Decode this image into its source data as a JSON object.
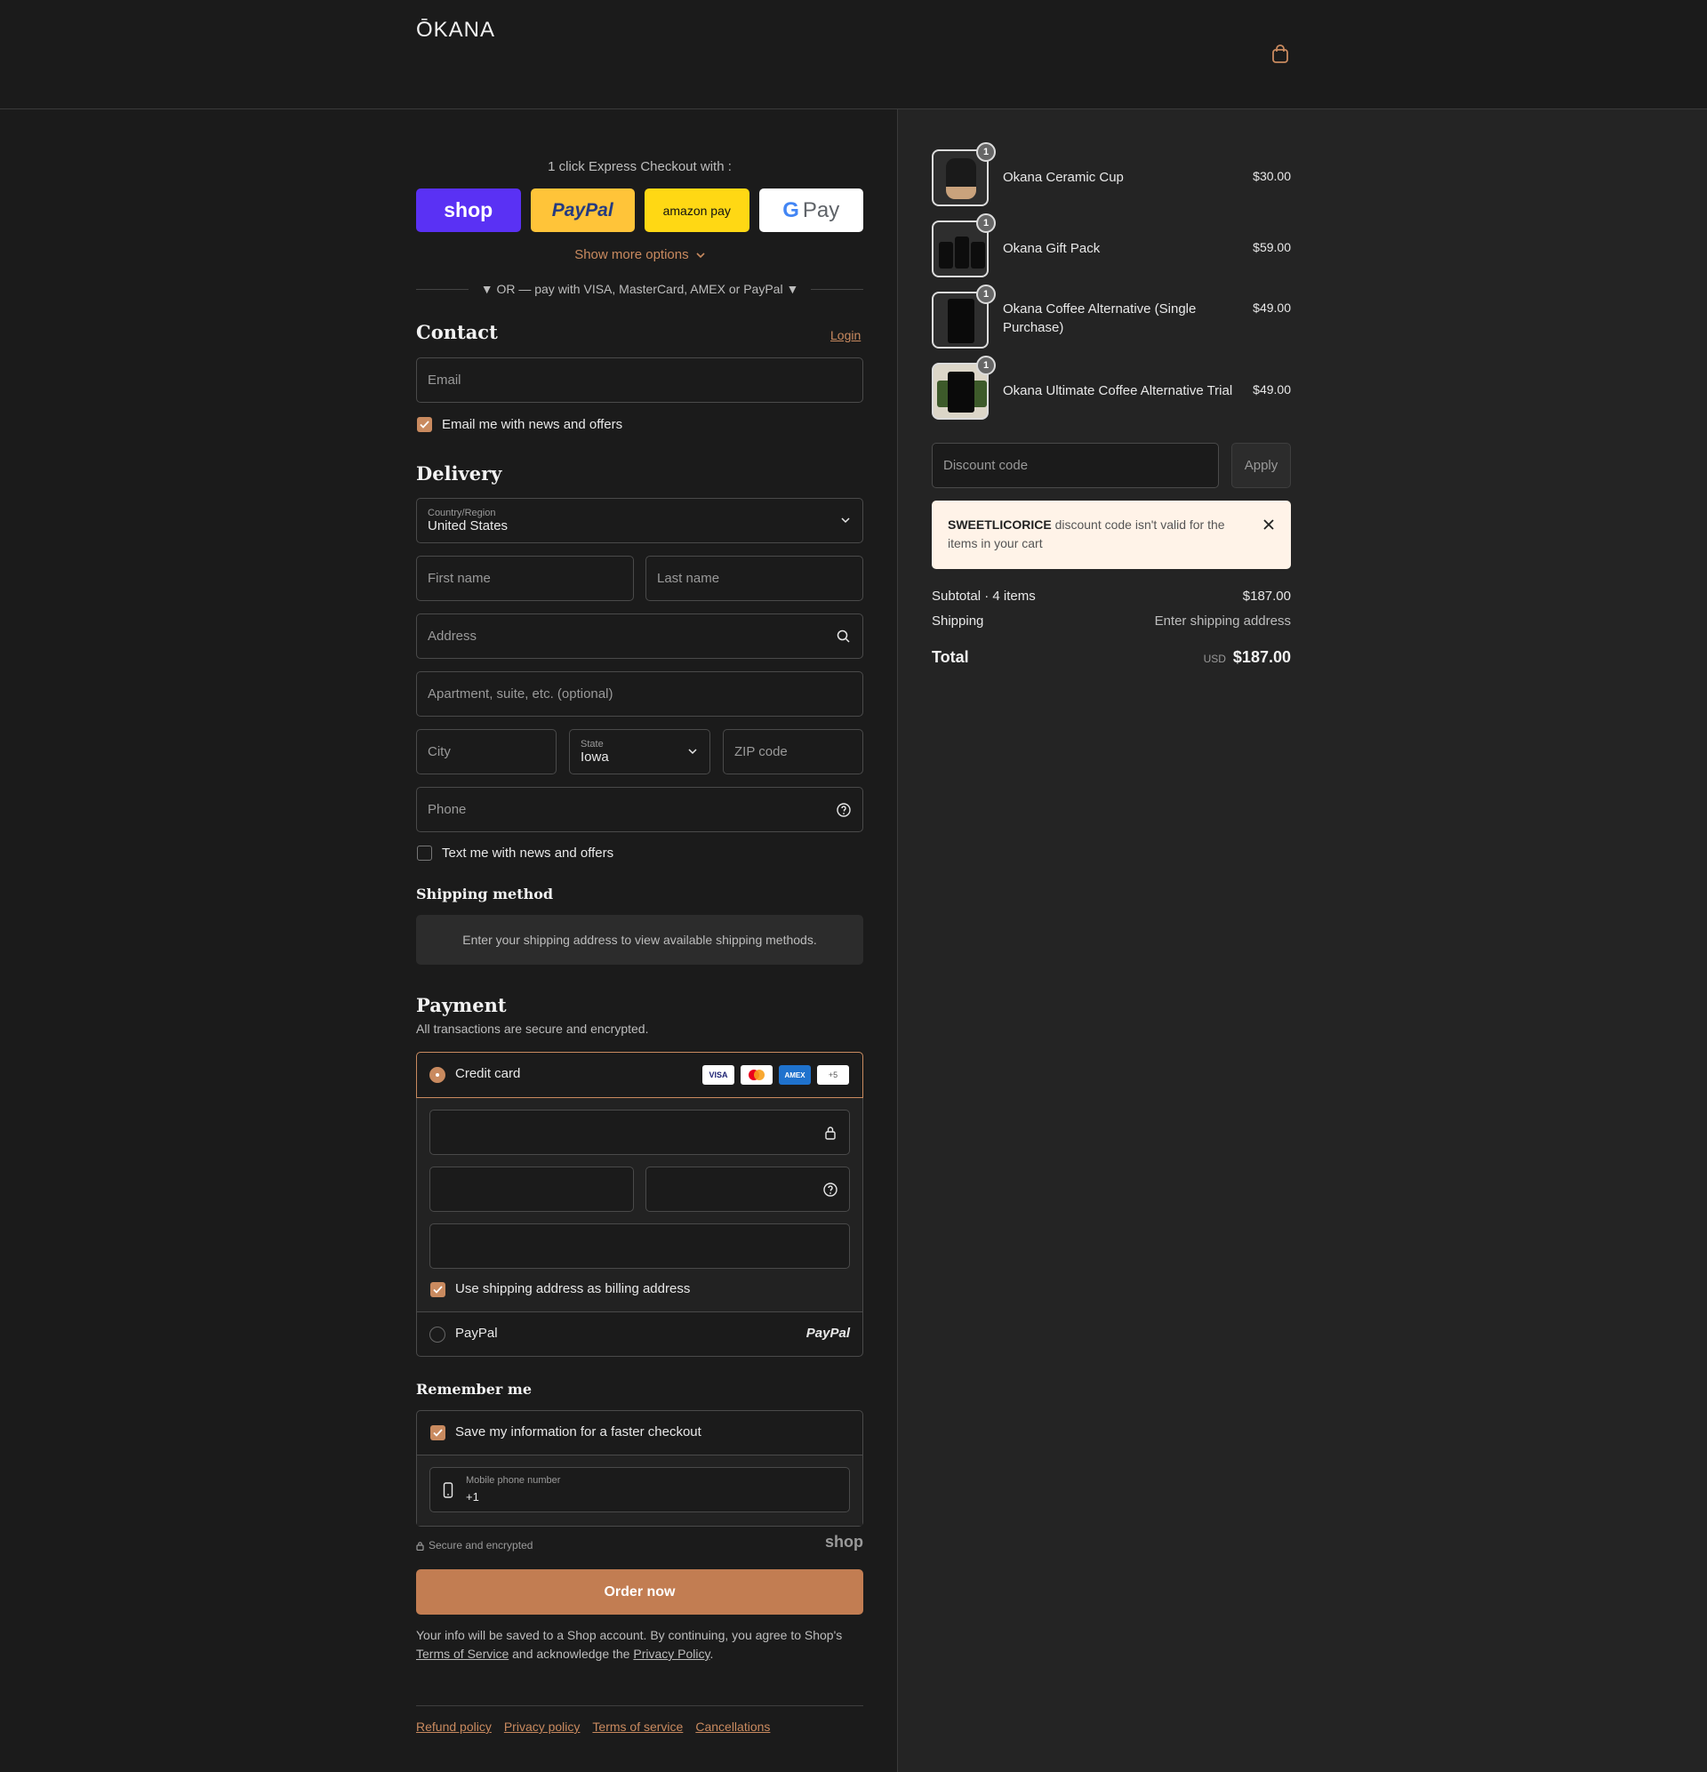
{
  "header": {
    "logo": "ŌKANA",
    "cart_icon": "shopping-bag-icon"
  },
  "express": {
    "title": "1 click Express Checkout with :",
    "buttons": {
      "shop": "shop",
      "paypal": "PayPal",
      "amazon": "amazon pay",
      "gpay_g": "G",
      "gpay": "Pay"
    },
    "show_more": "Show more options",
    "or_text": "▼ OR — pay with VISA, MasterCard, AMEX or PayPal ▼"
  },
  "contact": {
    "title": "Contact",
    "login": "Login",
    "email_placeholder": "Email",
    "news_label": "Email me with news and offers"
  },
  "delivery": {
    "title": "Delivery",
    "country_label": "Country/Region",
    "country_value": "United States",
    "first_name": "First name",
    "last_name": "Last name",
    "address": "Address",
    "apartment": "Apartment, suite, etc. (optional)",
    "city": "City",
    "state_label": "State",
    "state_value": "Iowa",
    "zip": "ZIP code",
    "phone": "Phone",
    "text_label": "Text me with news and offers"
  },
  "shipping_method": {
    "title": "Shipping method",
    "info": "Enter your shipping address to view available shipping methods."
  },
  "payment": {
    "title": "Payment",
    "subtitle": "All transactions are secure and encrypted.",
    "credit_card": "Credit card",
    "card_logos": {
      "visa": "VISA",
      "amex": "AMEX",
      "more": "+5"
    },
    "billing_label": "Use shipping address as billing address",
    "paypal": "PayPal",
    "paypal_logo": "PayPal"
  },
  "remember": {
    "title": "Remember me",
    "save_label": "Save my information for a faster checkout",
    "mobile_label": "Mobile phone number",
    "mobile_value": "+1"
  },
  "secure": {
    "text": "Secure and encrypted",
    "shop_logo": "shop"
  },
  "order_button": "Order now",
  "legal": {
    "text1": "Your info will be saved to a Shop account. By continuing, you agree to Shop's",
    "terms": "Terms of Service",
    "text2": "and acknowledge the",
    "privacy": "Privacy Policy",
    "end": "."
  },
  "footer": {
    "links": [
      "Refund policy",
      "Privacy policy",
      "Terms of service",
      "Cancellations"
    ]
  },
  "cart": {
    "items": [
      {
        "name": "Okana Ceramic Cup",
        "price": "$30.00",
        "qty": "1"
      },
      {
        "name": "Okana Gift Pack",
        "price": "$59.00",
        "qty": "1"
      },
      {
        "name": "Okana Coffee Alternative (Single Purchase)",
        "price": "$49.00",
        "qty": "1"
      },
      {
        "name": "Okana Ultimate Coffee Alternative Trial",
        "price": "$49.00",
        "qty": "1"
      }
    ],
    "discount_placeholder": "Discount code",
    "apply": "Apply",
    "alert_code": "SWEETLICORICE",
    "alert_text": "discount code isn't valid for the items in your cart",
    "subtotal_label": "Subtotal · 4 items",
    "subtotal_value": "$187.00",
    "shipping_label": "Shipping",
    "shipping_value": "Enter shipping address",
    "total_label": "Total",
    "currency": "USD",
    "total_value": "$187.00"
  },
  "colors": {
    "accent": "#c98a5f",
    "shop": "#5a31f4",
    "paypal": "#ffc439",
    "amazon": "#ffd814"
  }
}
